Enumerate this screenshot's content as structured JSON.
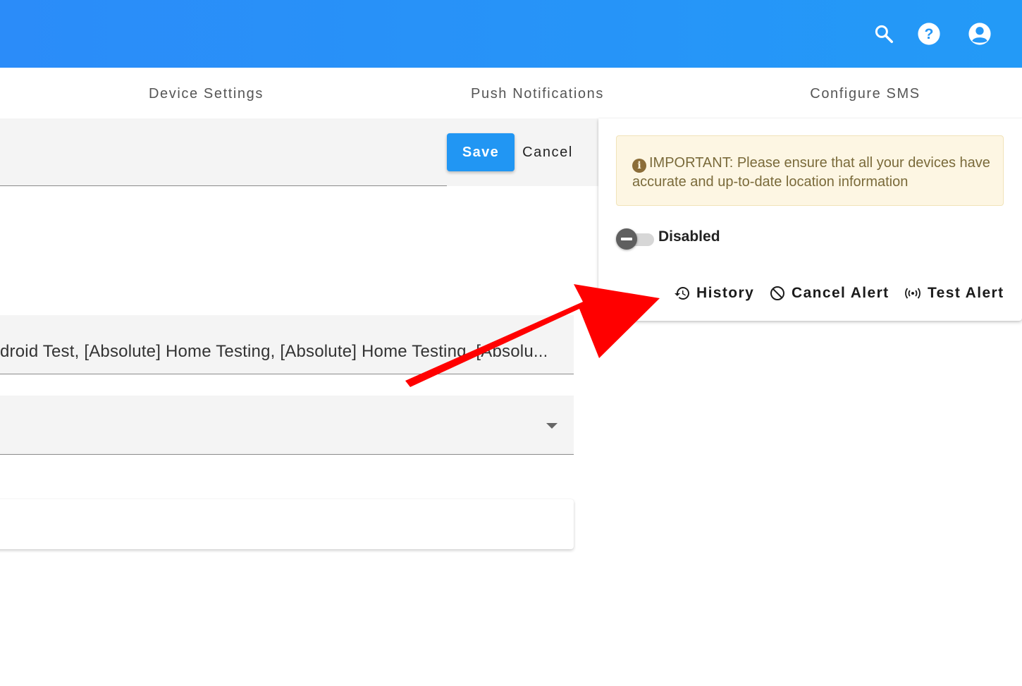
{
  "header": {
    "icons": [
      "search-icon",
      "help-icon",
      "account-icon"
    ],
    "accent_color": "#2196f3"
  },
  "tabs": [
    {
      "label": "Device Settings"
    },
    {
      "label": "Push Notifications"
    },
    {
      "label": "Configure SMS"
    }
  ],
  "toolbar": {
    "save_label": "Save",
    "cancel_label": "Cancel"
  },
  "form": {
    "devices_value": "droid Test, [Absolute] Home Testing, [Absolute] Home Testing, [Absolu...",
    "select_value": ""
  },
  "panel": {
    "notice_text": "IMPORTANT: Please ensure that all your devices have accurate and up-to-date location information",
    "notice_icon": "info-icon",
    "toggle_label": "Disabled",
    "toggle_enabled": false,
    "actions": [
      {
        "label": "History",
        "icon": "history-icon"
      },
      {
        "label": "Cancel Alert",
        "icon": "block-icon"
      },
      {
        "label": "Test Alert",
        "icon": "broadcast-icon"
      }
    ]
  },
  "annotation": {
    "arrow_color": "#ff0000"
  }
}
